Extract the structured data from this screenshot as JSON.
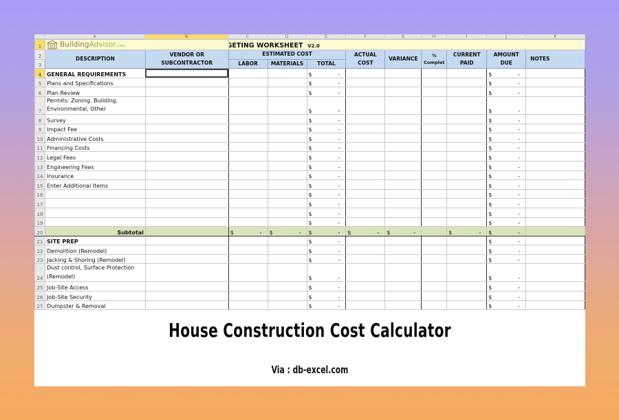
{
  "caption": {
    "title": "House Construction Cost Calculator",
    "via": "Via : db-excel.com"
  },
  "sheet": {
    "selected_column": "B",
    "column_letters": [
      "A",
      "B",
      "C",
      "D",
      "E",
      "F",
      "G",
      "H",
      "I",
      "J",
      "K"
    ],
    "logo": {
      "brand_part1": "Building",
      "brand_part2": "Advisor",
      "brand_suffix": ".com"
    },
    "title": "ESTIMATING & BUDGETING WORKSHEET",
    "version": "V2.0",
    "headers": {
      "description": "DESCRIPTION",
      "vendor": "VENDOR  OR",
      "vendor2": "SUBCONTRACTOR",
      "estimated_cost": "ESTIMATED COST",
      "labor": "LABOR",
      "materials": "MATERIALS",
      "total": "TOTAL",
      "actual": "ACTUAL",
      "actual2": "COST",
      "variance": "VARIANCE",
      "pct": "%",
      "pct2": "Complet",
      "current": "CURRENT",
      "current2": "PAID",
      "amount": "AMOUNT",
      "amount2": "DUE",
      "notes": "NOTES"
    },
    "currency_symbol": "$",
    "empty_value": "-",
    "subtotal_label": "Subtotal",
    "rows": [
      {
        "n": "4",
        "label": "GENERAL REQUIREMENTS",
        "bold": true
      },
      {
        "n": "5",
        "label": "Plans and Specifications"
      },
      {
        "n": "6",
        "label": "Plan Review"
      },
      {
        "n": "7",
        "label": "Permits: Zoning, Building,",
        "label2": "Environmental, Other"
      },
      {
        "n": "8",
        "label": "Survey"
      },
      {
        "n": "9",
        "label": "Impact Fee"
      },
      {
        "n": "10",
        "label": "Administrative Costs"
      },
      {
        "n": "11",
        "label": "Financing Costs"
      },
      {
        "n": "12",
        "label": "Legal Fees"
      },
      {
        "n": "13",
        "label": "Engineering Fees"
      },
      {
        "n": "14",
        "label": "Insurance"
      },
      {
        "n": "15",
        "label": "Enter Additional Items"
      },
      {
        "n": "16",
        "label": ""
      },
      {
        "n": "17",
        "label": ""
      },
      {
        "n": "18",
        "label": ""
      },
      {
        "n": "19",
        "label": ""
      },
      {
        "n": "20",
        "subtotal": true
      },
      {
        "n": "21",
        "label": "SITE PREP",
        "bold": true
      },
      {
        "n": "22",
        "label": "Demolition (Remodel)"
      },
      {
        "n": "23",
        "label": "Jacking & Shoring (Remodel)"
      },
      {
        "n": "24",
        "label": "Dust control, Surface Protection",
        "label2": "(Remodel)"
      },
      {
        "n": "25",
        "label": "Job-Site Access"
      },
      {
        "n": "26",
        "label": "Job-Site Security"
      },
      {
        "n": "27",
        "label": "Dumpster & Removal"
      }
    ]
  }
}
